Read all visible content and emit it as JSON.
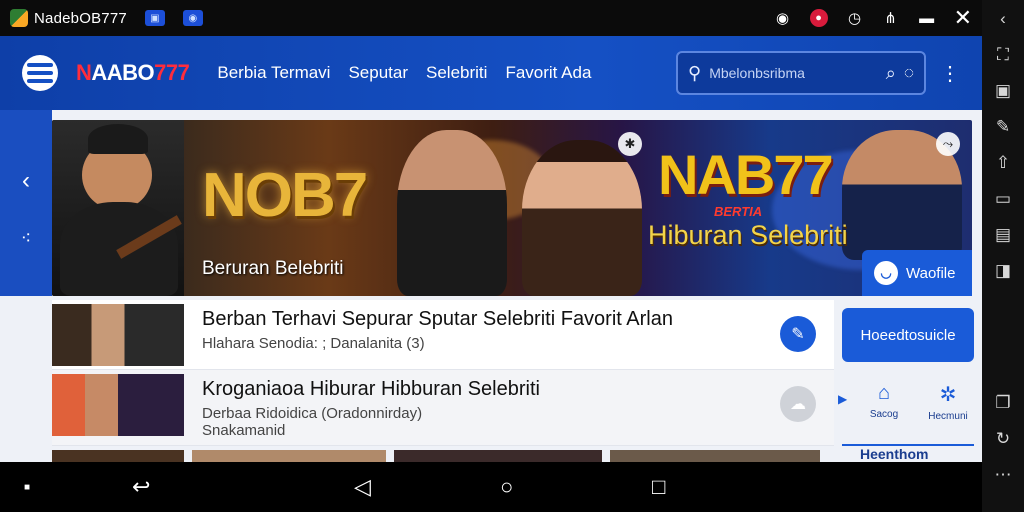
{
  "statusbar": {
    "app_name": "NadebOB777",
    "icons": [
      "app-logo-icon",
      "image-icon",
      "screenshot-icon",
      "record-icon",
      "notification-icon",
      "clock-icon",
      "wifi-icon",
      "battery-icon",
      "close-icon"
    ]
  },
  "header": {
    "brand_prefix": "N",
    "brand_rest": "AABO",
    "brand_suffix": "777",
    "nav": [
      "Berbia Termavi",
      "Seputar",
      "Selebriti",
      "Favorit Ada"
    ],
    "search_placeholder": "Mbelonbsribma"
  },
  "banner": {
    "title_left": "NOB7",
    "subtitle_left": "Beruran Belebriti",
    "title_right": "NAB77",
    "tag_right": "BERTIA",
    "subtitle_right": "Hiburan Selebriti",
    "mobile_button": "Waofile"
  },
  "articles": [
    {
      "headline": "Berban Terhavi Sepurar Sputar Selebriti Favorit Arlan",
      "meta": "Hlahara Senodia: ; Danalanita (3)",
      "meta2": ""
    },
    {
      "headline": "Kroganiaoa Hiburar Hibburan Selebriti",
      "meta": "Derbaa Ridoidica (Oradonnirday)",
      "meta2": "Snakamanid"
    }
  ],
  "sidebar": {
    "cta": "Hoeedtosuicle",
    "items": [
      {
        "label": "Sacog",
        "icon": "briefcase-icon"
      },
      {
        "label": "Hecmuni",
        "icon": "settings-icon"
      }
    ],
    "footer": "Heenthom"
  },
  "colors": {
    "header": "#1550c4",
    "accent": "#1a5bd8",
    "brand_red": "#ff2d3d",
    "gold": "#e8b53a"
  }
}
